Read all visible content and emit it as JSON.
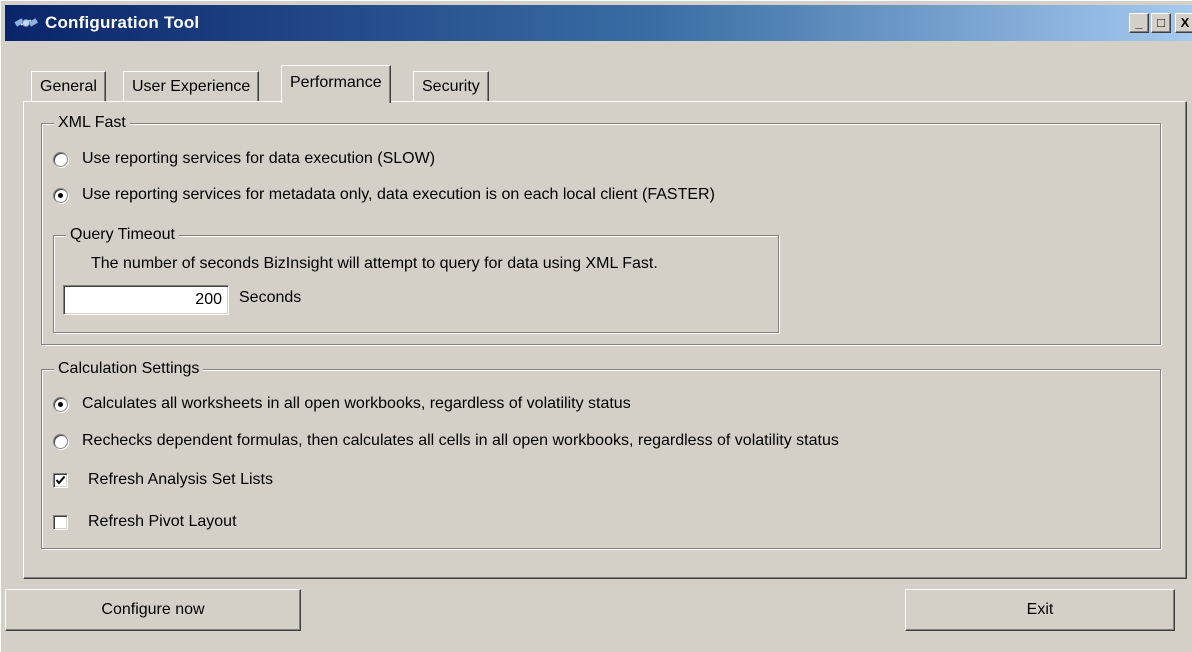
{
  "window": {
    "title": "Configuration Tool",
    "app_icon": "satellite-icon",
    "controls": {
      "minimize": "_",
      "maximize": "□",
      "close": "X"
    },
    "colors": {
      "titlebar_start": "#0a246a",
      "titlebar_end": "#a6caf0",
      "face": "#d4d0c8"
    }
  },
  "tabs": [
    {
      "label": "General",
      "active": false
    },
    {
      "label": "User Experience",
      "active": false
    },
    {
      "label": "Performance",
      "active": true
    },
    {
      "label": "Security",
      "active": false
    }
  ],
  "xml_fast": {
    "legend": "XML Fast",
    "options": [
      {
        "label": "Use reporting services for data execution  (SLOW)",
        "selected": false
      },
      {
        "label": "Use reporting services for metadata only, data execution is on each local client (FASTER)",
        "selected": true
      }
    ],
    "query_timeout": {
      "legend": "Query Timeout",
      "description": "The number of seconds BizInsight will attempt to query for data using XML Fast.",
      "value": "200",
      "unit_label": "Seconds"
    }
  },
  "calculation": {
    "legend": "Calculation Settings",
    "options": [
      {
        "label": "Calculates all worksheets in all open workbooks, regardless of volatility status",
        "selected": true
      },
      {
        "label": "Rechecks dependent formulas, then calculates all cells in all open workbooks, regardless of volatility status",
        "selected": false
      }
    ],
    "checkboxes": [
      {
        "label": "Refresh Analysis Set Lists",
        "checked": true
      },
      {
        "label": "Refresh Pivot Layout",
        "checked": false
      }
    ]
  },
  "buttons": {
    "configure": "Configure now",
    "exit": "Exit"
  }
}
